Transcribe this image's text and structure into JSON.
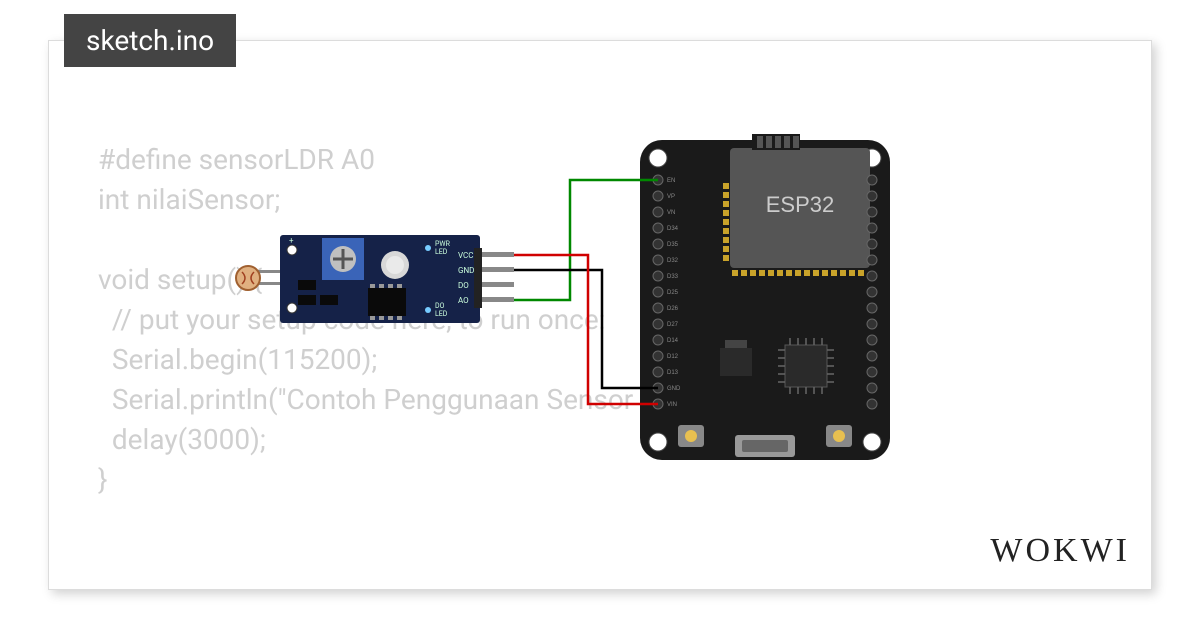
{
  "tab": {
    "label": "sketch.ino"
  },
  "code": {
    "line1": "#define sensorLDR A0",
    "line2": "int nilaiSensor;",
    "line3": "",
    "line4": "void setup() {",
    "line5": "  // put your setup code here, to run once:",
    "line6": "  Serial.begin(115200);",
    "line7": "  Serial.println(\"Contoh Penggunaan Sensor LDR\");",
    "line8": "  delay(3000);",
    "line9": "}"
  },
  "board": {
    "esp32_label": "ESP32",
    "ldr_labels": {
      "pwr": "PWR",
      "led": "LED",
      "do": "DO",
      "vcc": "VCC",
      "gnd": "GND",
      "dout": "DO",
      "ao": "AO"
    }
  },
  "logo": {
    "text": "WOKWI"
  },
  "wires": [
    {
      "name": "vcc-red",
      "color": "#d00000"
    },
    {
      "name": "gnd-black",
      "color": "#000000"
    },
    {
      "name": "ao-green",
      "color": "#008800"
    }
  ]
}
